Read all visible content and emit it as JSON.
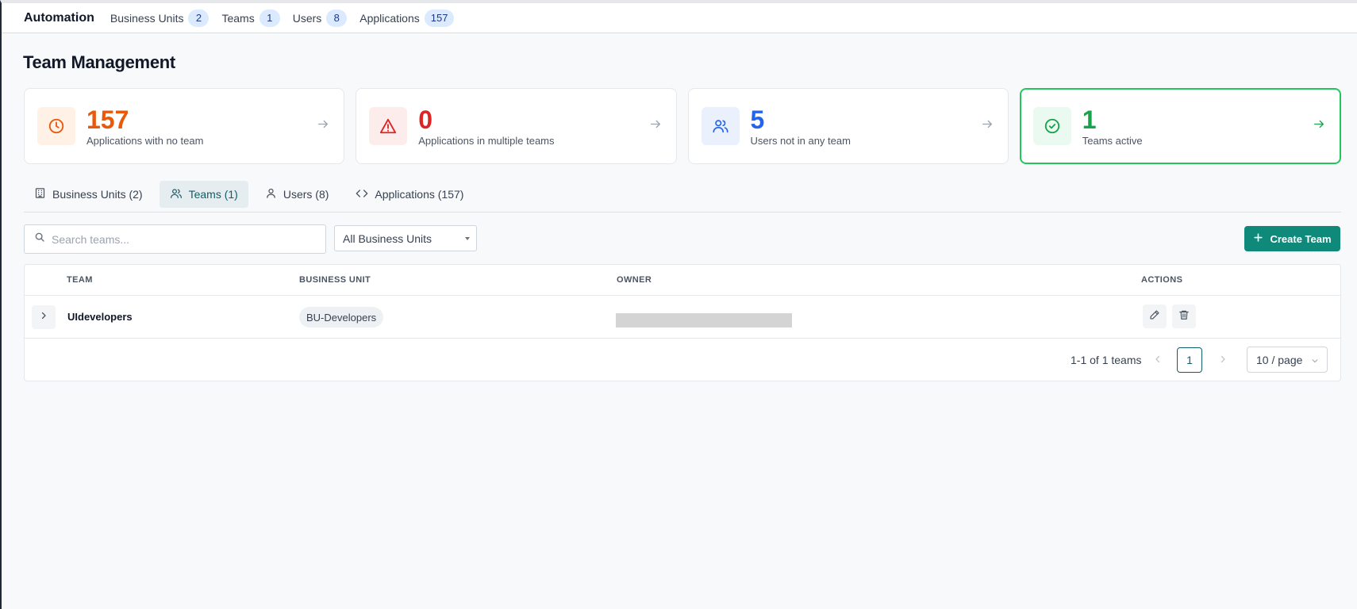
{
  "topnav": {
    "brand": "Automation",
    "items": [
      {
        "label": "Business Units",
        "count": "2"
      },
      {
        "label": "Teams",
        "count": "1"
      },
      {
        "label": "Users",
        "count": "8"
      },
      {
        "label": "Applications",
        "count": "157"
      }
    ]
  },
  "page_title": "Team Management",
  "cards": [
    {
      "value": "157",
      "label": "Applications with no team",
      "color": "#e8590c",
      "icon": "clock-icon"
    },
    {
      "value": "0",
      "label": "Applications in multiple teams",
      "color": "#dc2626",
      "icon": "warning-icon"
    },
    {
      "value": "5",
      "label": "Users not in any team",
      "color": "#2563eb",
      "icon": "users-icon"
    },
    {
      "value": "1",
      "label": "Teams active",
      "color": "#16a34a",
      "icon": "check-circle-icon"
    }
  ],
  "tabs": [
    {
      "label": "Business Units (2)",
      "icon": "building-icon"
    },
    {
      "label": "Teams (1)",
      "icon": "users-icon",
      "active": true
    },
    {
      "label": "Users (8)",
      "icon": "user-icon"
    },
    {
      "label": "Applications (157)",
      "icon": "code-icon"
    }
  ],
  "toolbar": {
    "search_placeholder": "Search teams...",
    "bu_filter": "All Business Units",
    "create_label": "Create Team"
  },
  "table": {
    "headers": {
      "team": "TEAM",
      "business_unit": "BUSINESS UNIT",
      "owner": "OWNER",
      "actions": "ACTIONS"
    },
    "rows": [
      {
        "team": "UIdevelopers",
        "business_unit": "BU-Developers"
      }
    ]
  },
  "pagination": {
    "info": "1-1 of 1 teams",
    "current_page": "1",
    "page_size": "10 / page"
  }
}
